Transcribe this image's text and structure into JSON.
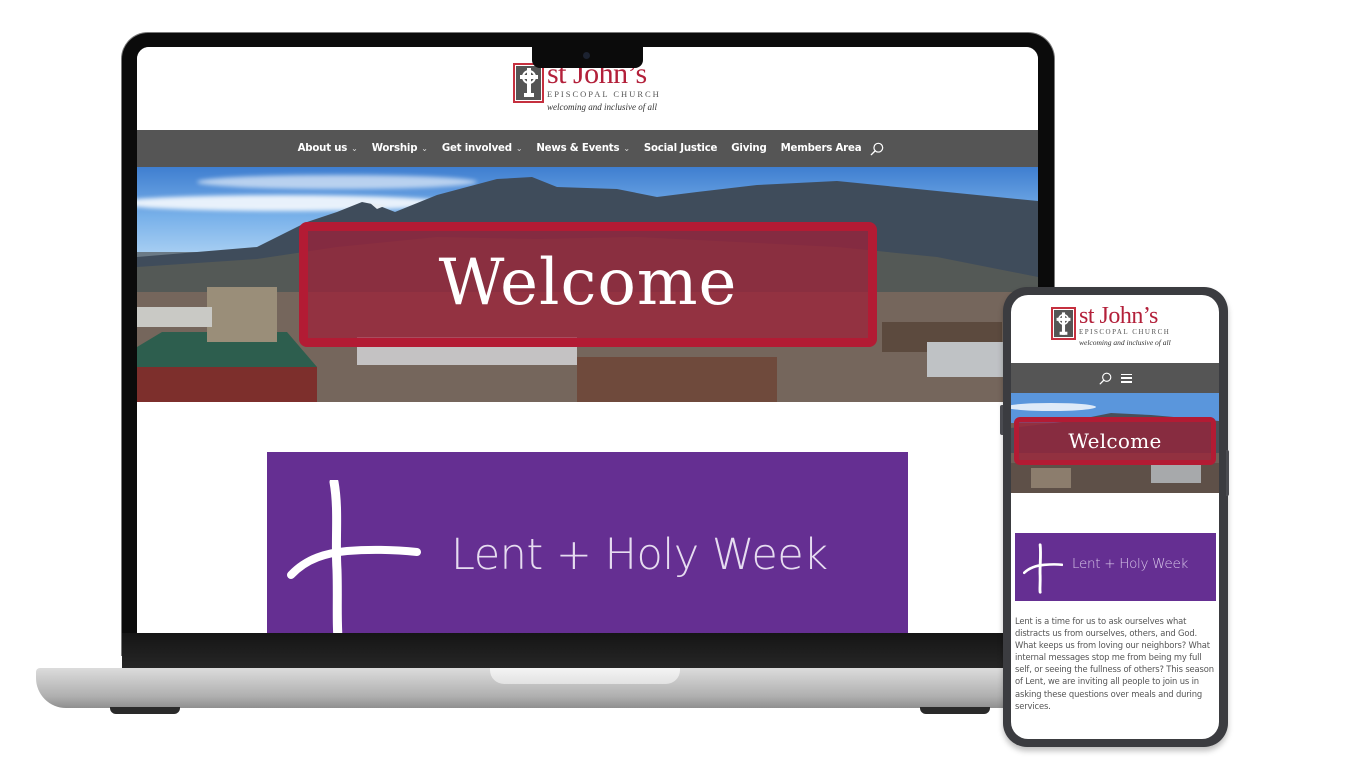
{
  "site": {
    "logo": {
      "wordmark": "st John’s",
      "subtitle": "EPISCOPAL CHURCH",
      "tagline": "welcoming and inclusive of all",
      "emblem_icon": "celtic-cross-icon"
    },
    "colors": {
      "brand_red": "#b31b34",
      "nav_gray": "#555555",
      "lent_purple": "#652f92",
      "nav_text": "#ffffff"
    }
  },
  "desktop": {
    "nav": {
      "items": [
        {
          "label": "About us",
          "has_dropdown": true
        },
        {
          "label": "Worship",
          "has_dropdown": true
        },
        {
          "label": "Get involved",
          "has_dropdown": true
        },
        {
          "label": "News & Events",
          "has_dropdown": true
        },
        {
          "label": "Social Justice",
          "has_dropdown": false
        },
        {
          "label": "Giving",
          "has_dropdown": false
        },
        {
          "label": "Members Area",
          "has_dropdown": false
        }
      ],
      "dropdown_glyph": "⌄",
      "search_icon": "search-icon"
    },
    "hero": {
      "heading": "Welcome",
      "image_description": "Boulder, Colorado skyline with Flatirons mountains"
    },
    "lent_banner": {
      "title": "Lent + Holy Week",
      "icon": "ash-cross-icon"
    }
  },
  "mobile": {
    "nav": {
      "search_icon": "search-icon",
      "menu_icon": "hamburger-menu-icon"
    },
    "hero": {
      "heading": "Welcome"
    },
    "lent_banner": {
      "title": "Lent + Holy Week"
    },
    "body_text": "Lent is a time for us to ask ourselves what distracts us from ourselves, others, and God. What keeps us from loving our neighbors? What internal messages stop me from being my full self, or seeing the fullness of others? This season of Lent, we are inviting all people to join us in asking these questions over meals and during services."
  }
}
